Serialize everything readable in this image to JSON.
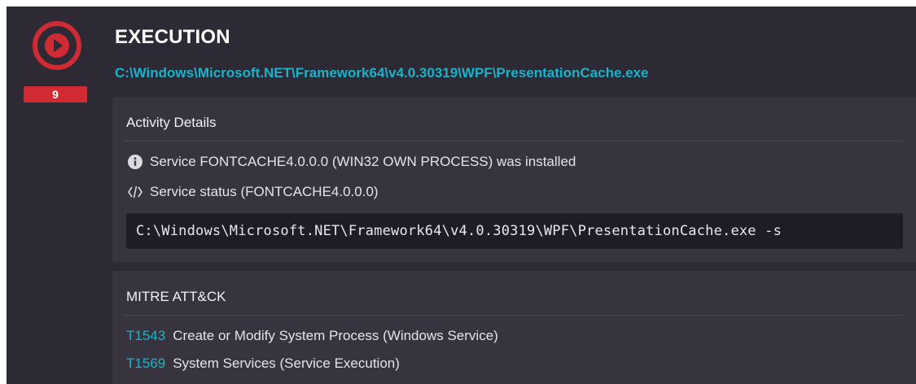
{
  "event": {
    "count": "9",
    "title": "EXECUTION",
    "path": "C:\\Windows\\Microsoft.NET\\Framework64\\v4.0.30319\\WPF\\PresentationCache.exe",
    "play_icon": "play-icon",
    "accent_color": "#d02a33"
  },
  "activity": {
    "header": "Activity Details",
    "items": [
      {
        "icon": "info-icon",
        "text": "Service FONTCACHE4.0.0.0 (WIN32 OWN PROCESS) was installed"
      },
      {
        "icon": "service-status-icon",
        "text": "Service status (FONTCACHE4.0.0.0)"
      }
    ],
    "command": "C:\\Windows\\Microsoft.NET\\Framework64\\v4.0.30319\\WPF\\PresentationCache.exe -s"
  },
  "mitre": {
    "header": "MITRE ATT&CK",
    "techniques": [
      {
        "id": "T1543",
        "name": "Create or Modify System Process (Windows Service)"
      },
      {
        "id": "T1569",
        "name": "System Services (Service Execution)"
      }
    ],
    "link_color": "#1bb3c9"
  }
}
